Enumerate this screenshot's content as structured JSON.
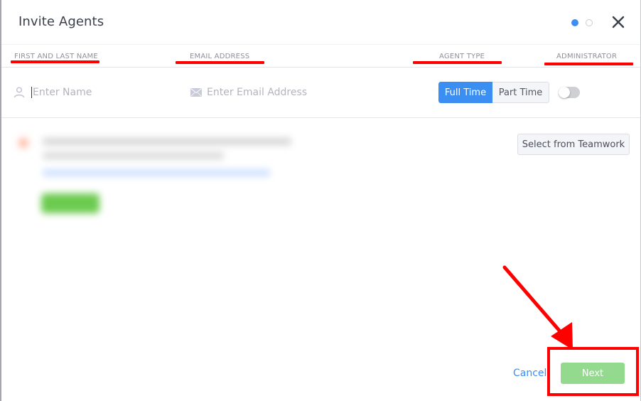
{
  "dialog": {
    "title": "Invite Agents",
    "steps": {
      "total": 2,
      "current": 1
    },
    "close_label": "Close"
  },
  "columns": {
    "name": "FIRST AND LAST NAME",
    "email": "EMAIL ADDRESS",
    "agent_type": "AGENT TYPE",
    "administrator": "ADMINISTRATOR"
  },
  "row": {
    "name": {
      "value": "",
      "placeholder": "Enter Name",
      "icon": "user-icon"
    },
    "email": {
      "value": "",
      "placeholder": "Enter Email Address",
      "icon": "envelope-icon"
    },
    "agent_type": {
      "options": [
        "Full Time",
        "Part Time"
      ],
      "selected": "Full Time"
    },
    "administrator": {
      "enabled": false
    }
  },
  "actions": {
    "select_from_teamwork": "Select from Teamwork",
    "cancel": "Cancel",
    "next": "Next"
  },
  "colors": {
    "accent": "#3d8ef2",
    "next_button": "#93da8f",
    "annotation": "#ff0000"
  }
}
